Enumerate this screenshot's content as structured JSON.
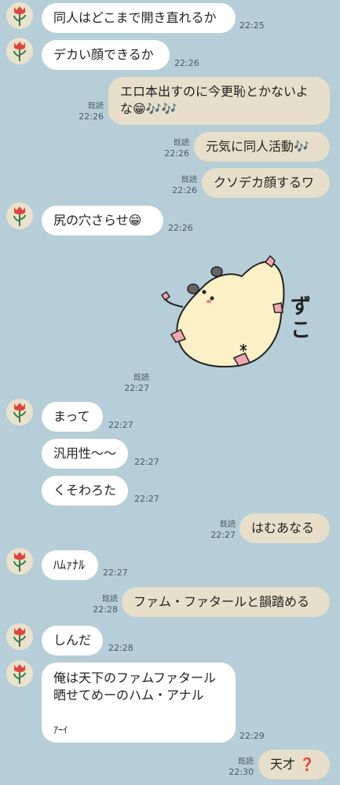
{
  "messages": [
    {
      "text": "同人はどこまで開き直れるか",
      "time": "22:25"
    },
    {
      "text": "デカい顔できるか",
      "time": "22:26"
    },
    {
      "line1": "エロ本出すのに今更恥とかないよ",
      "line2": "な😁🎶🎶",
      "read": "既読",
      "time": "22:26"
    },
    {
      "text": "元気に同人活動🎶",
      "read": "既読",
      "time": "22:26"
    },
    {
      "text": "クソデカ顔するワ",
      "read": "既読",
      "time": "22:26"
    },
    {
      "text": "尻の穴さらせ😁",
      "time": "22:26"
    },
    {
      "sticker_text": "ずこ",
      "read": "既読",
      "time": "22:27"
    },
    {
      "text": "まって",
      "time": "22:27"
    },
    {
      "text": "汎用性〜〜",
      "time": "22:27"
    },
    {
      "text": "くそわろた",
      "time": "22:27"
    },
    {
      "text": "はむあなる",
      "read": "既読",
      "time": "22:27"
    },
    {
      "text": "ﾊﾑｧﾅﾙ",
      "time": "22:27"
    },
    {
      "text": "ファム・ファタールと韻踏める",
      "read": "既読",
      "time": "22:28"
    },
    {
      "text": "しんだ",
      "time": "22:28"
    },
    {
      "line1": "俺は天下のファムファタール",
      "line2": "晒せてめーのハム・アナル",
      "line3": "ｱｰｲ",
      "time": "22:29"
    },
    {
      "text": "天才",
      "emoji": "❓",
      "read": "既読",
      "time": "22:30"
    }
  ],
  "colors": {
    "background": "#b5ced7",
    "incoming": "#ffffff",
    "outgoing": "#e8dfca"
  },
  "icons": {
    "avatar": "red-tulip-avatar-icon"
  }
}
